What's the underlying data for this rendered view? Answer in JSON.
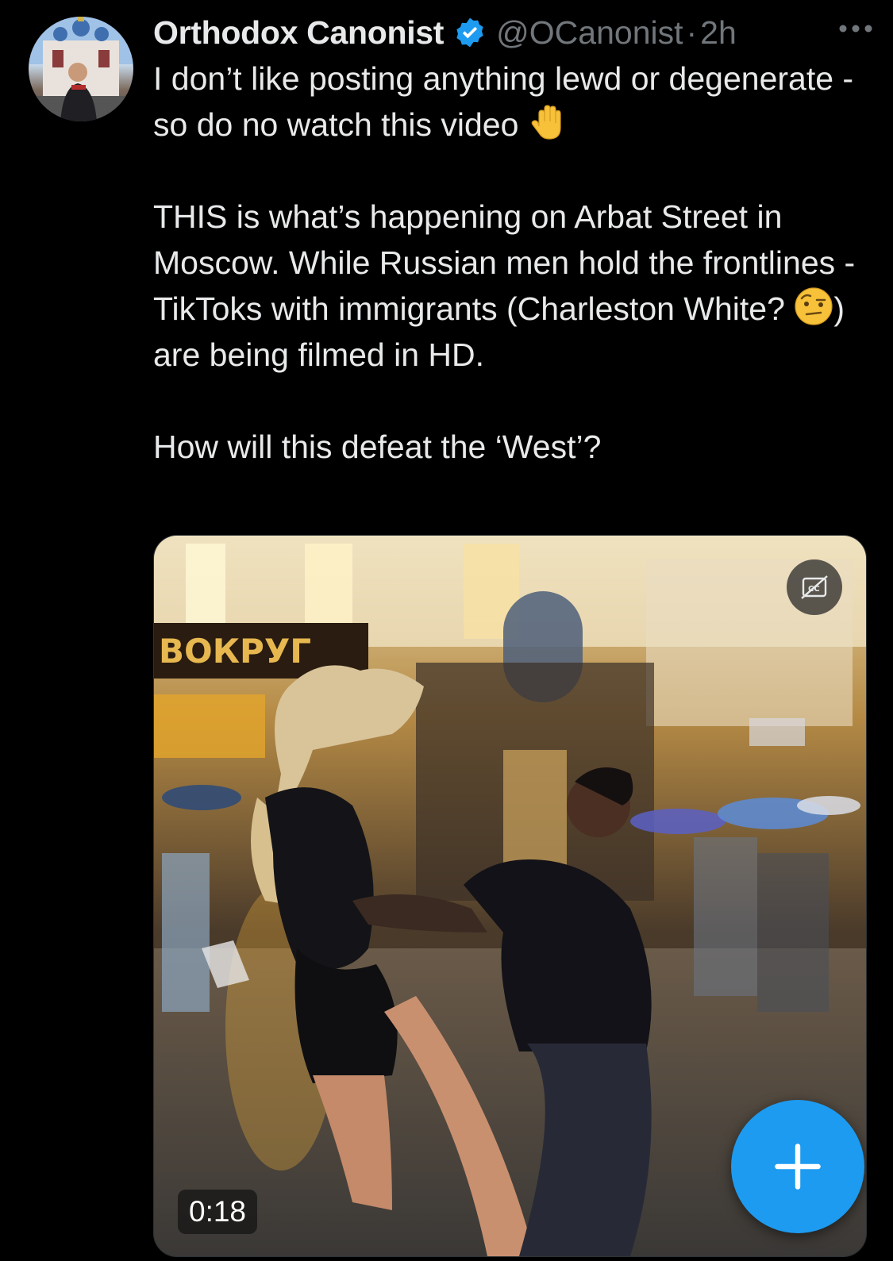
{
  "author": {
    "display_name": "Orthodox Canonist",
    "handle": "@OCanonist",
    "separator": "·",
    "time": "2h",
    "verified": true
  },
  "tweet": {
    "paragraph1_part1": "I don’t like posting anything lewd or degenerate - so do no watch this video ",
    "paragraph1_emoji": "raised-hand-emoji",
    "paragraph2_part1": "THIS is what’s happening on Arbat Street in Moscow. While Russian men hold the frontlines - TikToks with immigrants (Charleston White? ",
    "paragraph2_emoji": "face-with-raised-eyebrow-emoji",
    "paragraph2_part2": ") are being filmed in HD.",
    "paragraph3": "How will this defeat the ‘West’?"
  },
  "media": {
    "type": "video",
    "duration": "0:18",
    "captions_icon": "captions-off-icon"
  },
  "compose_button": {
    "icon": "plus-icon"
  },
  "colors": {
    "background": "#000000",
    "text": "#e7e9ea",
    "secondary": "#71767b",
    "accent": "#1d9bf0"
  }
}
